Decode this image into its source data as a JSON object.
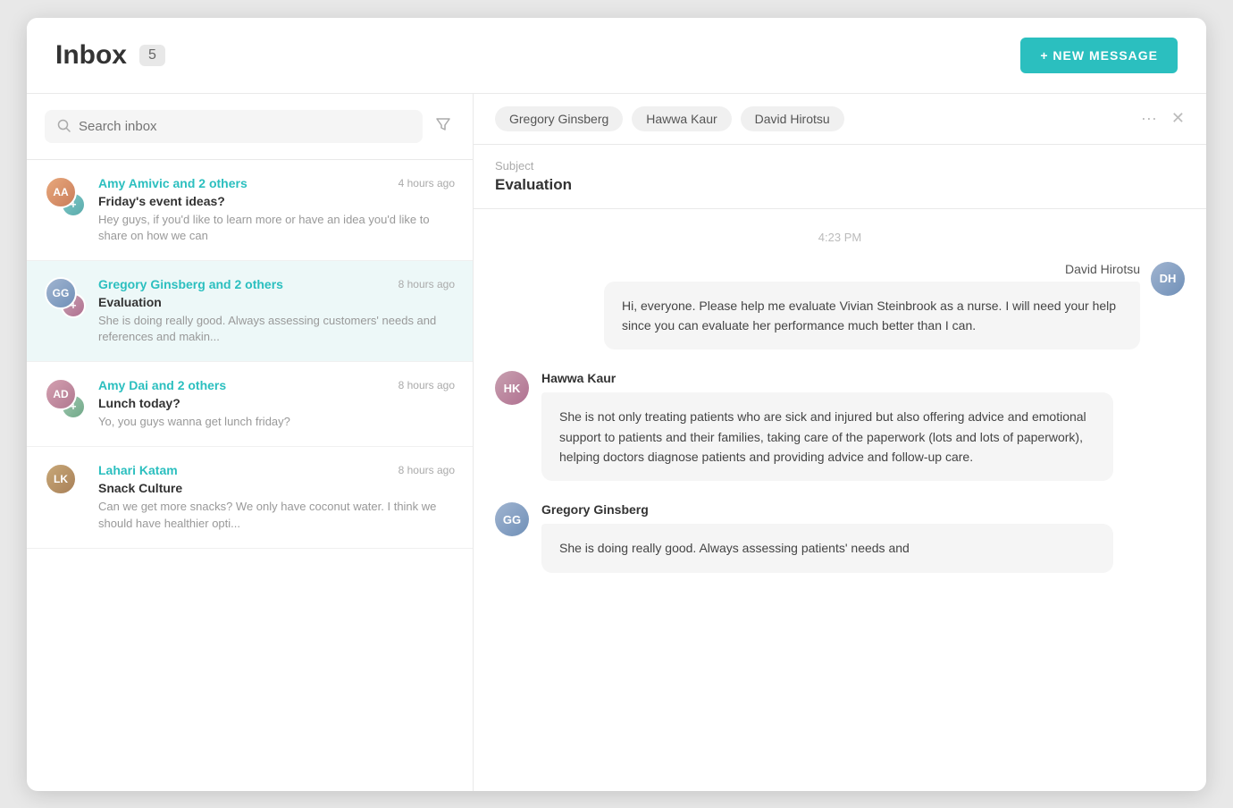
{
  "header": {
    "title": "Inbox",
    "badge": "5",
    "new_message_label": "+ NEW MESSAGE"
  },
  "search": {
    "placeholder": "Search inbox"
  },
  "messages": [
    {
      "id": 1,
      "sender": "Amy Amivic and 2 others",
      "time": "4 hours ago",
      "subject": "Friday's event ideas?",
      "preview": "Hey guys, if you'd like to learn more or have an idea  you'd like to share on how we can",
      "active": false
    },
    {
      "id": 2,
      "sender": "Gregory Ginsberg and 2 others",
      "time": "8 hours ago",
      "subject": "Evaluation",
      "preview": "She is doing really good. Always assessing customers' needs and references and makin...",
      "active": true
    },
    {
      "id": 3,
      "sender": "Amy Dai and 2 others",
      "time": "8 hours ago",
      "subject": "Lunch today?",
      "preview": "Yo, you guys wanna get lunch friday?",
      "active": false
    },
    {
      "id": 4,
      "sender": "Lahari Katam",
      "time": "8 hours ago",
      "subject": "Snack Culture",
      "preview": "Can we get more snacks? We only have coconut water. I think we should have healthier opti...",
      "active": false
    }
  ],
  "conversation": {
    "recipients": [
      "Gregory Ginsberg",
      "Hawwa Kaur",
      "David Hirotsu"
    ],
    "subject_label": "Subject",
    "subject": "Evaluation",
    "timestamp": "4:23 PM",
    "thread": [
      {
        "id": 1,
        "type": "sent",
        "author": "David Hirotsu",
        "body": "Hi, everyone. Please help me evaluate Vivian Steinbrook as a nurse. I will need your help since you can evaluate her performance much better than I can."
      },
      {
        "id": 2,
        "type": "received",
        "author": "Hawwa Kaur",
        "avatar_style": "hawwa",
        "body": "She is not only treating patients who are sick and injured but also offering advice and emotional support to patients and their families, taking care of the paperwork (lots and lots of paperwork), helping doctors diagnose patients and providing advice and follow-up care."
      },
      {
        "id": 3,
        "type": "received",
        "author": "Gregory Ginsberg",
        "avatar_style": "gregory",
        "body": "She is doing really good. Always assessing patients' needs and"
      }
    ]
  }
}
